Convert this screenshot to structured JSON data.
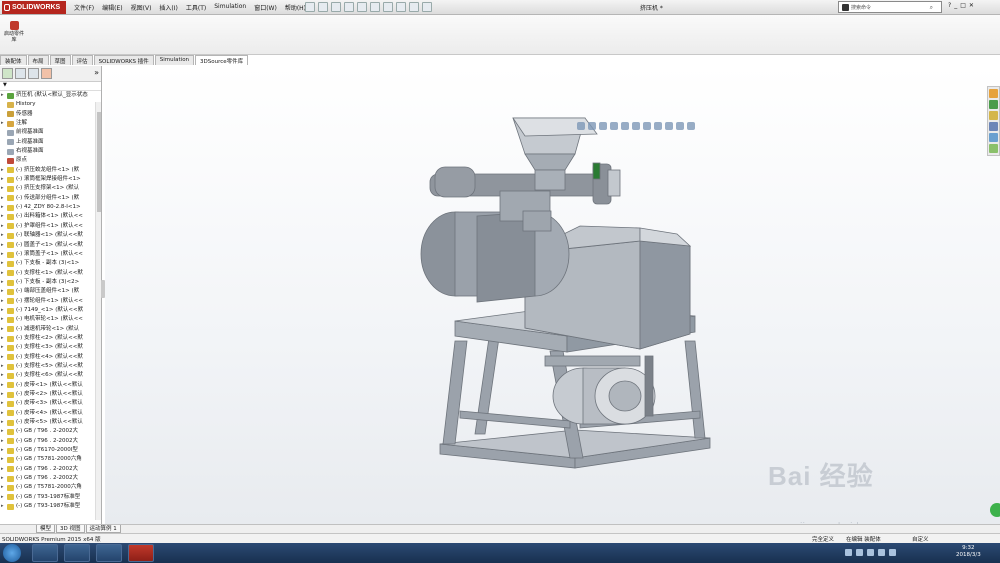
{
  "app": {
    "logo_text": "SOLIDWORKS",
    "doc_title": "挤压机 *"
  },
  "menu": [
    "文件(F)",
    "编辑(E)",
    "视图(V)",
    "插入(I)",
    "工具(T)",
    "Simulation",
    "窗口(W)",
    "帮助(H)"
  ],
  "search": {
    "placeholder": "搜索命令"
  },
  "ribbon": {
    "button_label": "启动零件库"
  },
  "tabs": [
    "装配体",
    "布局",
    "草图",
    "评估",
    "SOLIDWORKS 插件",
    "Simulation",
    "3DSource零件库"
  ],
  "active_tab": "3DSource零件库",
  "tree": {
    "filter_label": "▼",
    "items": [
      {
        "label": "挤压机  (默认<默认_显示状态",
        "type": "assembly"
      },
      {
        "label": "History",
        "type": "history"
      },
      {
        "label": "传感器",
        "type": "sensor"
      },
      {
        "label": "注解",
        "type": "annotation"
      },
      {
        "label": "前视基准面",
        "type": "plane"
      },
      {
        "label": "上视基准面",
        "type": "plane"
      },
      {
        "label": "右视基准面",
        "type": "plane"
      },
      {
        "label": "原点",
        "type": "origin"
      },
      {
        "label": "(-) 挤压蛟龙组件<1> (默",
        "type": "part"
      },
      {
        "label": "(-) 滚筒框架焊接组件<1>",
        "type": "part"
      },
      {
        "label": "(-) 挤压支撑架<1> (默认",
        "type": "part"
      },
      {
        "label": "(-) 传送部分组件<1> (默",
        "type": "part"
      },
      {
        "label": "(-) 42_ZDY 80-2.8-I<1>",
        "type": "part"
      },
      {
        "label": "(-) 出料箱体<1> (默认<<",
        "type": "part"
      },
      {
        "label": "(-) 护罩组件<1> (默认<<",
        "type": "part"
      },
      {
        "label": "(-) 联轴器<1> (默认<<默",
        "type": "part"
      },
      {
        "label": "(-) 圆盖子<1> (默认<<默",
        "type": "part"
      },
      {
        "label": "(-) 滚筒盖子<1> (默认<<",
        "type": "part"
      },
      {
        "label": "(-) 下支板 - 副本 (3)<1>",
        "type": "part"
      },
      {
        "label": "(-) 支撑柱<1> (默认<<默",
        "type": "part"
      },
      {
        "label": "(-) 下支板 - 副本 (3)<2>",
        "type": "part"
      },
      {
        "label": "(-) 端部压盖组件<1> (默",
        "type": "part"
      },
      {
        "label": "(-) 摆轮组件<1> (默认<<",
        "type": "part"
      },
      {
        "label": "(-) 7149_<1> (默认<<默",
        "type": "part"
      },
      {
        "label": "(-) 电机带轮<1> (默认<<",
        "type": "part"
      },
      {
        "label": "(-) 减速机带轮<1> (默认",
        "type": "part"
      },
      {
        "label": "(-) 支撑柱<2> (默认<<默",
        "type": "part"
      },
      {
        "label": "(-) 支撑柱<3> (默认<<默",
        "type": "part"
      },
      {
        "label": "(-) 支撑柱<4> (默认<<默",
        "type": "part"
      },
      {
        "label": "(-) 支撑柱<5> (默认<<默",
        "type": "part"
      },
      {
        "label": "(-) 支撑柱<6> (默认<<默",
        "type": "part"
      },
      {
        "label": "(-) 皮带<1> (默认<<默认",
        "type": "part"
      },
      {
        "label": "(-) 皮带<2> (默认<<默认",
        "type": "part"
      },
      {
        "label": "(-) 皮带<3> (默认<<默认",
        "type": "part"
      },
      {
        "label": "(-) 皮带<4> (默认<<默认",
        "type": "part"
      },
      {
        "label": "(-) 皮带<5> (默认<<默认",
        "type": "part"
      },
      {
        "label": "(-) GB / T96 . 2-2002大",
        "type": "part"
      },
      {
        "label": "(-) GB / T96 . 2-2002大",
        "type": "part"
      },
      {
        "label": "(-) GB / T6170-2000I型",
        "type": "part"
      },
      {
        "label": "(-) GB / T5781-2000六角",
        "type": "part"
      },
      {
        "label": "(-) GB / T96 . 2-2002大",
        "type": "part"
      },
      {
        "label": "(-) GB / T96 . 2-2002大",
        "type": "part"
      },
      {
        "label": "(-) GB / T5781-2000六角",
        "type": "part"
      },
      {
        "label": "(-) GB / T93-1987标准型",
        "type": "part"
      },
      {
        "label": "(-) GB / T93-1987标准型",
        "type": "part"
      }
    ]
  },
  "bottom_tabs": [
    "模型",
    "3D 视图",
    "运动算例 1"
  ],
  "status": {
    "left": "SOLIDWORKS Premium 2015 x64 版",
    "underdefined": "完全定义",
    "editing": "在编辑 装配体",
    "custom": "自定义"
  },
  "taskbar": {
    "time": "9:32",
    "date": "2018/3/3"
  },
  "watermark": {
    "brand": "Bai 经验",
    "url": "jingyan.baidu.com"
  },
  "colors": {
    "accent": "#b5261e",
    "taskbar": "#1f3a60",
    "machine": "#a7adb5"
  }
}
